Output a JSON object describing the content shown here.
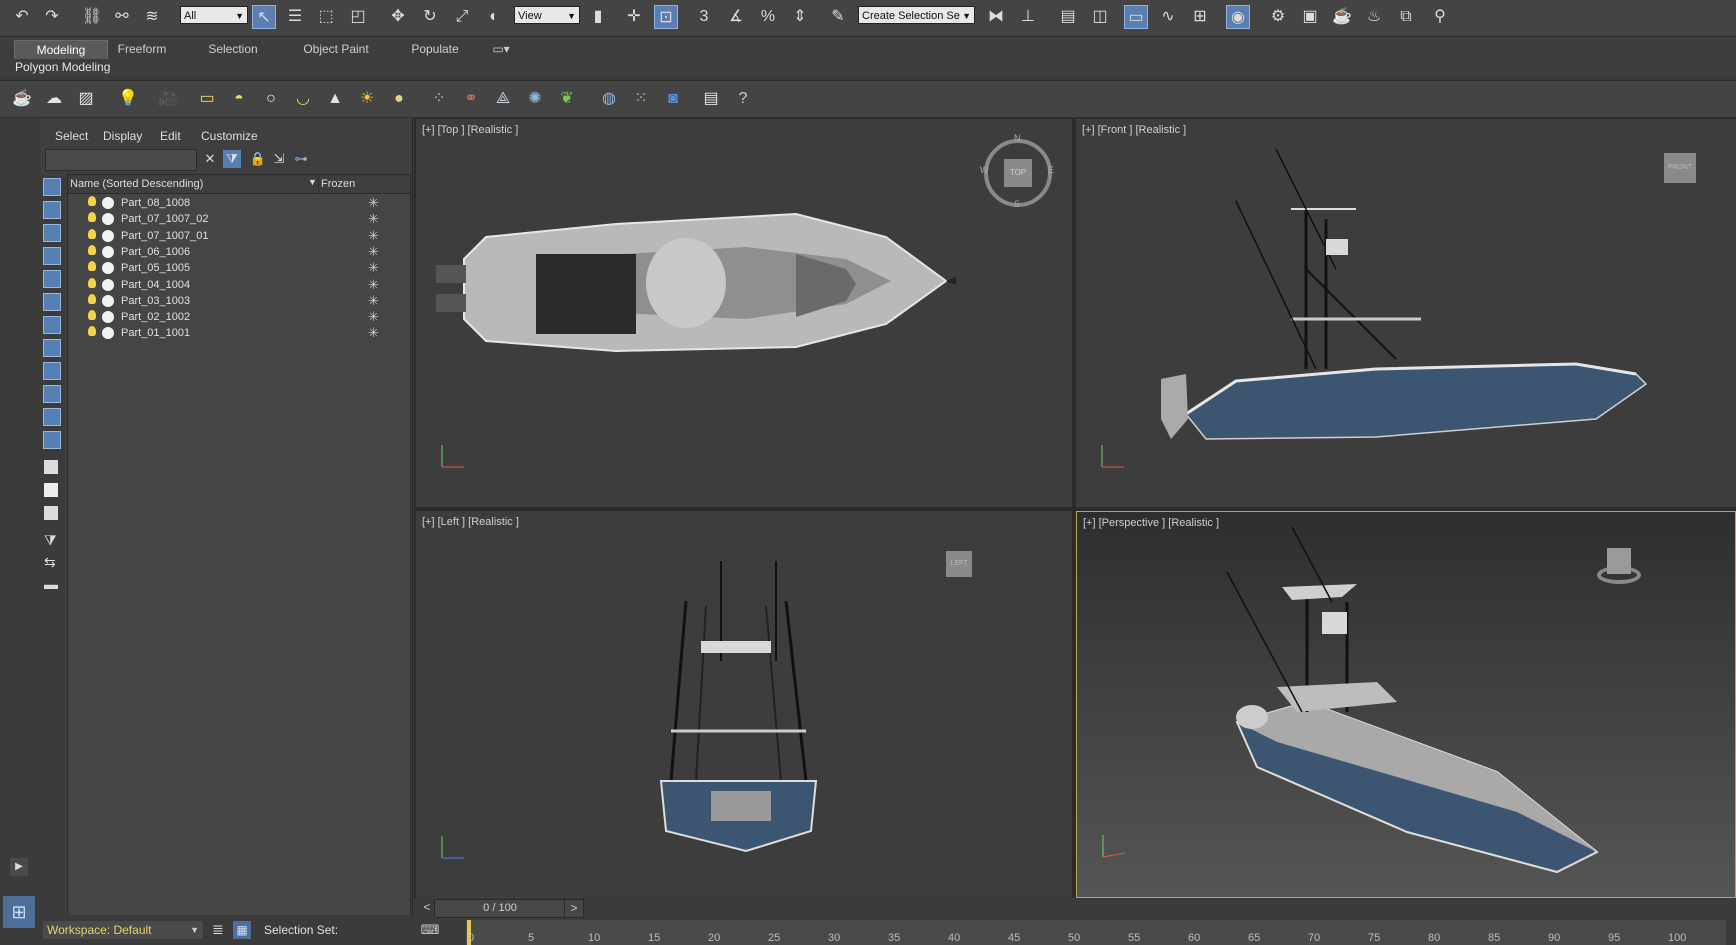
{
  "toolbar": {
    "filter_value": "All",
    "view_value": "View",
    "selection_set_placeholder": "Create Selection Se",
    "snap_angle_label": "3",
    "percent_label": "%"
  },
  "ribbon": {
    "tabs": [
      "Modeling",
      "Freeform",
      "Selection",
      "Object Paint",
      "Populate"
    ],
    "active_tab": "Modeling",
    "panel_label": "Polygon Modeling"
  },
  "scene_explorer": {
    "menu": [
      "Select",
      "Display",
      "Edit",
      "Customize"
    ],
    "column_name": "Name (Sorted Descending)",
    "column_frozen": "Frozen",
    "rows": [
      "Part_08_1008",
      "Part_07_1007_02",
      "Part_07_1007_01",
      "Part_06_1006",
      "Part_05_1005",
      "Part_04_1004",
      "Part_03_1003",
      "Part_02_1002",
      "Part_01_1001"
    ]
  },
  "viewports": {
    "top": {
      "label": "[+] [Top ] [Realistic ]",
      "cube": "TOP",
      "compass": [
        "N",
        "E",
        "S",
        "W"
      ]
    },
    "front": {
      "label": "[+] [Front ] [Realistic ]",
      "cube": "FRONT"
    },
    "left": {
      "label": "[+] [Left ] [Realistic ]",
      "cube": "LEFT"
    },
    "perspective": {
      "label": "[+] [Perspective ] [Realistic ]"
    }
  },
  "timeline": {
    "slider_text": "0 / 100",
    "prev": "<",
    "next": ">",
    "ticks": [
      "0",
      "5",
      "10",
      "15",
      "20",
      "25",
      "30",
      "35",
      "40",
      "45",
      "50",
      "55",
      "60",
      "65",
      "70",
      "75",
      "80",
      "85",
      "90",
      "95",
      "100"
    ]
  },
  "status": {
    "workspace": "Workspace: Default",
    "selection_set": "Selection Set:"
  },
  "colors": {
    "active_blue": "#5a7fb0",
    "hull_blue": "#3c5570",
    "workspace_text": "#e7d36a",
    "persp_border": "#b8a85a"
  }
}
